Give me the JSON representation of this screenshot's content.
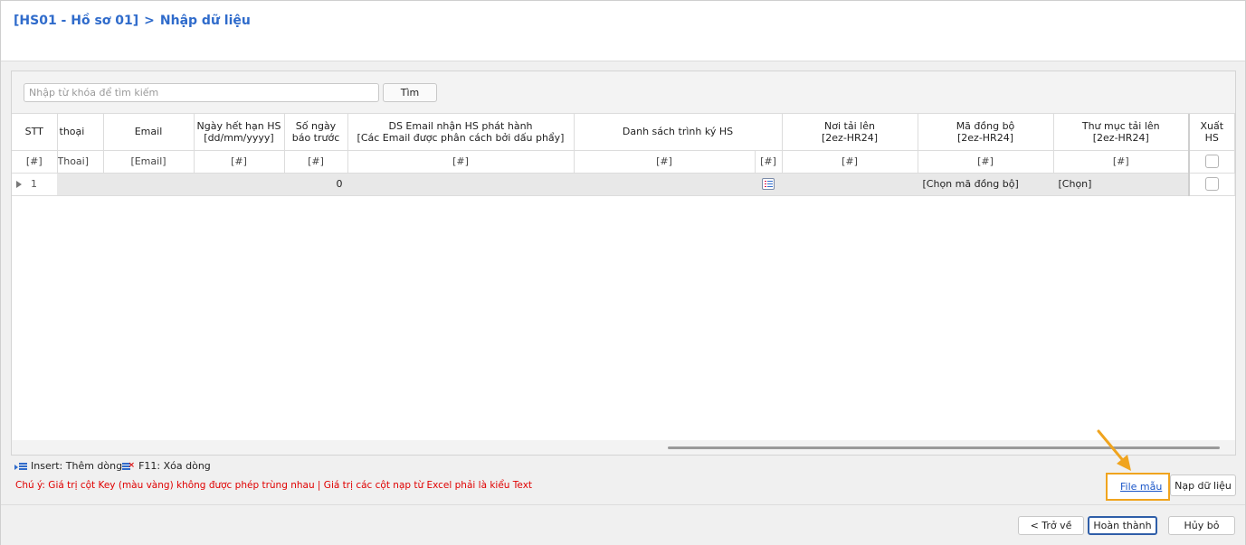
{
  "header": {
    "breadcrumb_code": "[HS01 - Hồ sơ 01]",
    "breadcrumb_sep": ">",
    "breadcrumb_page": "Nhập dữ liệu"
  },
  "search": {
    "placeholder": "Nhập từ khóa để tìm kiếm",
    "button_label": "Tìm"
  },
  "grid": {
    "columns": [
      {
        "key": "stt",
        "line1": "STT",
        "line2": ""
      },
      {
        "key": "phone",
        "line1": "thoại",
        "line2": ""
      },
      {
        "key": "email",
        "line1": "Email",
        "line2": ""
      },
      {
        "key": "expiry",
        "line1": "Ngày hết hạn HS",
        "line2": "[dd/mm/yyyy]"
      },
      {
        "key": "notice_days",
        "line1": "Số ngày",
        "line2": "báo trước"
      },
      {
        "key": "email_list",
        "line1": "DS Email nhận HS phát hành",
        "line2": "[Các Email được phân cách bởi dấu phẩy]"
      },
      {
        "key": "signers",
        "line1": "Danh sách trình ký HS",
        "line2": ""
      },
      {
        "key": "upload_place",
        "line1": "Nơi tải lên",
        "line2": "[2ez-HR24]"
      },
      {
        "key": "sync_code",
        "line1": "Mã đồng bộ",
        "line2": "[2ez-HR24]"
      },
      {
        "key": "upload_folder",
        "line1": "Thư mục tải lên",
        "line2": "[2ez-HR24]"
      },
      {
        "key": "export",
        "line1": "Xuất",
        "line2": "HS"
      }
    ],
    "filters": {
      "stt": "[#]",
      "phone": "Thoai]",
      "email": "[Email]",
      "expiry": "[#]",
      "notice_days": "[#]",
      "email_list": "[#]",
      "signers": "[#]",
      "signers_btn": "[#]",
      "upload_place": "[#]",
      "sync_code": "[#]",
      "upload_folder": "[#]"
    },
    "rows": [
      {
        "stt": "1",
        "notice_days": "0",
        "sync_code": "[Chọn mã đồng bộ]",
        "upload_folder": "[Chọn]"
      }
    ]
  },
  "hints": {
    "insert_text": "Insert: Thêm dòng",
    "delete_text": "F11: Xóa dòng",
    "warning": "Chú ý: Giá trị cột Key (màu vàng) không được phép trùng nhau | Giá trị các cột nạp từ Excel phải là kiểu Text"
  },
  "actions": {
    "sample_file": "File mẫu",
    "import": "Nạp dữ liệu"
  },
  "footer": {
    "back": "< Trở về",
    "finish": "Hoàn thành",
    "cancel": "Hủy bỏ"
  },
  "colors": {
    "accent": "#2f6bcb",
    "warning": "#e00000",
    "highlight": "#f0a41e",
    "row_bg": "#e8e8e8"
  }
}
